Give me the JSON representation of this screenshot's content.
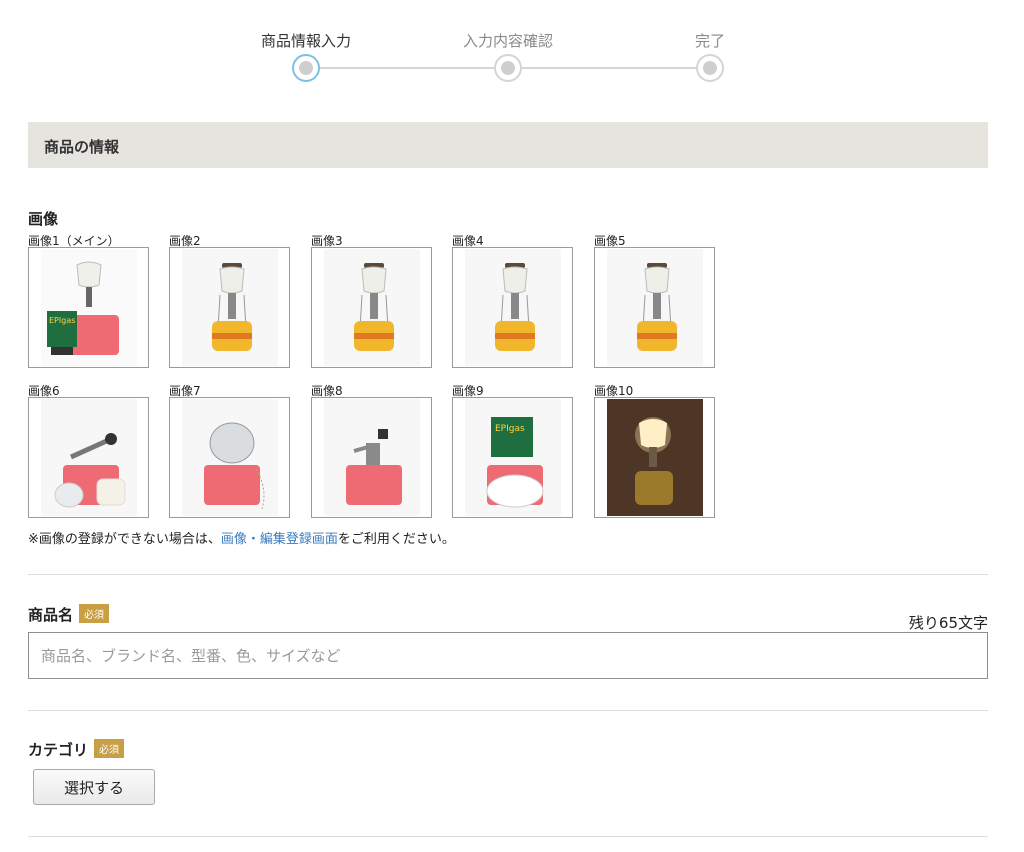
{
  "stepper": {
    "steps": [
      {
        "label": "商品情報入力",
        "active": true
      },
      {
        "label": "入力内容確認",
        "active": false
      },
      {
        "label": "完了",
        "active": false
      }
    ]
  },
  "section": {
    "title": "商品の情報"
  },
  "images": {
    "title": "画像",
    "thumbnails": [
      {
        "label": "画像1（メイン）",
        "icon": "lantern-with-case-and-package"
      },
      {
        "label": "画像2",
        "icon": "lantern-front-photo"
      },
      {
        "label": "画像3",
        "icon": "lantern-side-photo"
      },
      {
        "label": "画像4",
        "icon": "lantern-side-photo"
      },
      {
        "label": "画像5",
        "icon": "lantern-back-photo"
      },
      {
        "label": "画像6",
        "icon": "lantern-parts-on-case"
      },
      {
        "label": "画像7",
        "icon": "case-with-globe"
      },
      {
        "label": "画像8",
        "icon": "burner-on-case"
      },
      {
        "label": "画像9",
        "icon": "mantle-package-on-case"
      },
      {
        "label": "画像10",
        "icon": "lit-lantern-dark-photo"
      }
    ],
    "note_prefix": "※画像の登録ができない場合は、",
    "note_link": "画像・編集登録画面",
    "note_suffix": "をご利用ください。"
  },
  "product_name": {
    "label": "商品名",
    "required_badge": "必須",
    "counter": "残り65文字",
    "value": "",
    "placeholder": "商品名、ブランド名、型番、色、サイズなど"
  },
  "category": {
    "label": "カテゴリ",
    "required_badge": "必須",
    "button_label": "選択する"
  },
  "colors": {
    "badge": "#c89f42",
    "link": "#3a7bbf",
    "active_step": "#7fc0e4",
    "section_bg": "#e6e4df"
  }
}
